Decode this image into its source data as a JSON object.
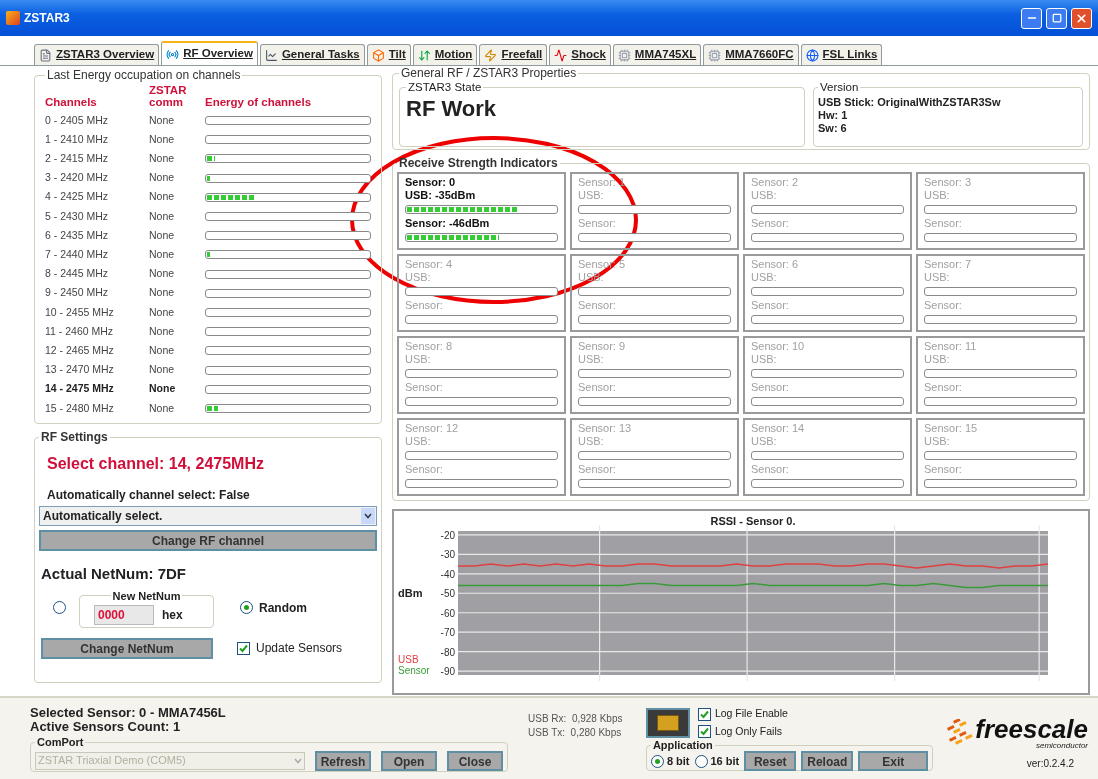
{
  "window": {
    "title": "ZSTAR3"
  },
  "tabs": [
    {
      "label": "ZSTAR3 Overview",
      "selected": false
    },
    {
      "label": "RF Overview",
      "selected": true
    },
    {
      "label": "General Tasks",
      "selected": false
    },
    {
      "label": "Tilt",
      "selected": false
    },
    {
      "label": "Motion",
      "selected": false
    },
    {
      "label": "Freefall",
      "selected": false
    },
    {
      "label": "Shock",
      "selected": false
    },
    {
      "label": "MMA745XL",
      "selected": false
    },
    {
      "label": "MMA7660FC",
      "selected": false
    },
    {
      "label": "FSL Links",
      "selected": false
    }
  ],
  "energy_panel": {
    "title": "Last Energy occupation on channels",
    "columns": [
      "Channels",
      "ZSTAR comm",
      "Energy of channels"
    ],
    "channels": [
      {
        "name": "0 - 2405 MHz",
        "comm": "None",
        "level": 0,
        "selected": false
      },
      {
        "name": "1 - 2410 MHz",
        "comm": "None",
        "level": 0,
        "selected": false
      },
      {
        "name": "2 - 2415 MHz",
        "comm": "None",
        "level": 0.05,
        "selected": false
      },
      {
        "name": "3 - 2420 MHz",
        "comm": "None",
        "level": 0.02,
        "selected": false
      },
      {
        "name": "4 - 2425 MHz",
        "comm": "None",
        "level": 0.3,
        "selected": false
      },
      {
        "name": "5 - 2430 MHz",
        "comm": "None",
        "level": 0,
        "selected": false
      },
      {
        "name": "6 - 2435 MHz",
        "comm": "None",
        "level": 0,
        "selected": false
      },
      {
        "name": "7 - 2440 MHz",
        "comm": "None",
        "level": 0.02,
        "selected": false
      },
      {
        "name": "8 - 2445 MHz",
        "comm": "None",
        "level": 0,
        "selected": false
      },
      {
        "name": "9 - 2450 MHz",
        "comm": "None",
        "level": 0,
        "selected": false
      },
      {
        "name": "10 - 2455 MHz",
        "comm": "None",
        "level": 0,
        "selected": false
      },
      {
        "name": "11 - 2460 MHz",
        "comm": "None",
        "level": 0,
        "selected": false
      },
      {
        "name": "12 - 2465 MHz",
        "comm": "None",
        "level": 0,
        "selected": false
      },
      {
        "name": "13 - 2470 MHz",
        "comm": "None",
        "level": 0,
        "selected": false
      },
      {
        "name": "14 - 2475 MHz",
        "comm": "None",
        "level": 0,
        "selected": true
      },
      {
        "name": "15 - 2480 MHz",
        "comm": "None",
        "level": 0.07,
        "selected": false
      }
    ]
  },
  "rf_settings": {
    "title": "RF Settings",
    "selected_channel": "Select channel: 14, 2475MHz",
    "auto_status": "Automatically channel select: False",
    "dropdown_value": "Automatically select.",
    "change_channel_button": "Change RF channel",
    "actual_netnum": "Actual NetNum: 7DF",
    "netnum_group": "New NetNum",
    "netnum_radio_selected": false,
    "netnum_value": "0000",
    "netnum_unit": "hex",
    "random_label": "Random",
    "random_selected": true,
    "change_netnum_button": "Change NetNum",
    "update_sensors_label": "Update Sensors",
    "update_sensors_checked": true
  },
  "properties": {
    "title": "General RF / ZSTAR3 Properties",
    "state_title": "ZSTAR3 State",
    "state": "RF Work",
    "version_title": "Version",
    "version_lines": [
      "USB Stick: OriginalWithZSTAR3Sw",
      "Hw: 1",
      "Sw: 6"
    ]
  },
  "indicators": {
    "title": "Receive Strength Indicators",
    "sensors": [
      {
        "title": "Sensor: 0",
        "usb": {
          "label": "USB: -35dBm",
          "level": 0.75
        },
        "sensor": {
          "label": "Sensor: -46dBm",
          "level": 0.62
        },
        "active": true
      },
      {
        "title": "Sensor: 1",
        "usb": {
          "label": "USB:",
          "level": 0
        },
        "sensor": {
          "label": "Sensor:",
          "level": 0
        },
        "active": false
      },
      {
        "title": "Sensor: 2",
        "usb": {
          "label": "USB:",
          "level": 0
        },
        "sensor": {
          "label": "Sensor:",
          "level": 0
        },
        "active": false
      },
      {
        "title": "Sensor: 3",
        "usb": {
          "label": "USB:",
          "level": 0
        },
        "sensor": {
          "label": "Sensor:",
          "level": 0
        },
        "active": false
      },
      {
        "title": "Sensor: 4",
        "usb": {
          "label": "USB:",
          "level": 0
        },
        "sensor": {
          "label": "Sensor:",
          "level": 0
        },
        "active": false
      },
      {
        "title": "Sensor: 5",
        "usb": {
          "label": "USB:",
          "level": 0
        },
        "sensor": {
          "label": "Sensor:",
          "level": 0
        },
        "active": false
      },
      {
        "title": "Sensor: 6",
        "usb": {
          "label": "USB:",
          "level": 0
        },
        "sensor": {
          "label": "Sensor:",
          "level": 0
        },
        "active": false
      },
      {
        "title": "Sensor: 7",
        "usb": {
          "label": "USB:",
          "level": 0
        },
        "sensor": {
          "label": "Sensor:",
          "level": 0
        },
        "active": false
      },
      {
        "title": "Sensor: 8",
        "usb": {
          "label": "USB:",
          "level": 0
        },
        "sensor": {
          "label": "Sensor:",
          "level": 0
        },
        "active": false
      },
      {
        "title": "Sensor: 9",
        "usb": {
          "label": "USB:",
          "level": 0
        },
        "sensor": {
          "label": "Sensor:",
          "level": 0
        },
        "active": false
      },
      {
        "title": "Sensor: 10",
        "usb": {
          "label": "USB:",
          "level": 0
        },
        "sensor": {
          "label": "Sensor:",
          "level": 0
        },
        "active": false
      },
      {
        "title": "Sensor: 11",
        "usb": {
          "label": "USB:",
          "level": 0
        },
        "sensor": {
          "label": "Sensor:",
          "level": 0
        },
        "active": false
      },
      {
        "title": "Sensor: 12",
        "usb": {
          "label": "USB:",
          "level": 0
        },
        "sensor": {
          "label": "Sensor:",
          "level": 0
        },
        "active": false
      },
      {
        "title": "Sensor: 13",
        "usb": {
          "label": "USB:",
          "level": 0
        },
        "sensor": {
          "label": "Sensor:",
          "level": 0
        },
        "active": false
      },
      {
        "title": "Sensor: 14",
        "usb": {
          "label": "USB:",
          "level": 0
        },
        "sensor": {
          "label": "Sensor:",
          "level": 0
        },
        "active": false
      },
      {
        "title": "Sensor: 15",
        "usb": {
          "label": "USB:",
          "level": 0
        },
        "sensor": {
          "label": "Sensor:",
          "level": 0
        },
        "active": false
      }
    ]
  },
  "rssi_chart": {
    "chart_data": {
      "type": "line",
      "grid": true,
      "title": "RSSI - Sensor 0.",
      "ylabel": "dBm",
      "ylim": [
        -92,
        -18
      ],
      "yticks": [
        -20,
        -30,
        -40,
        -50,
        -60,
        -70,
        -80,
        -90
      ],
      "series": [
        {
          "name": "USB",
          "color": "#e04040",
          "values": [
            -36,
            -36,
            -35,
            -36,
            -35,
            -36,
            -35,
            -36,
            -35,
            -36,
            -36,
            -35,
            -35,
            -36,
            -36,
            -36,
            -36,
            -35,
            -36,
            -36,
            -35,
            -35,
            -35,
            -36,
            -36,
            -35,
            -35,
            -36,
            -37,
            -36,
            -35,
            -36,
            -36,
            -37,
            -36,
            -36,
            -35
          ]
        },
        {
          "name": "Sensor",
          "color": "#3a9a3a",
          "values": [
            -46,
            -46,
            -46,
            -46,
            -46,
            -46,
            -46,
            -46,
            -46,
            -46,
            -46,
            -45,
            -45,
            -46,
            -46,
            -46,
            -46,
            -46,
            -45,
            -46,
            -46,
            -46,
            -46,
            -46,
            -46,
            -46,
            -45,
            -46,
            -46,
            -45,
            -46,
            -47,
            -47,
            -46,
            -46,
            -46,
            -46
          ]
        }
      ]
    }
  },
  "status": {
    "selected_sensor": "Selected Sensor: 0 - MMA7456L",
    "active_count": "Active Sensors Count: 1",
    "comport_title": "ComPort",
    "comport_value": "ZSTAR Triaxial Demo (COM5)",
    "comport_buttons": [
      "Refresh",
      "Open",
      "Close"
    ],
    "usb_rx": "USB Rx:  0,928 Kbps",
    "usb_tx": "USB Tx:  0,280 Kbps",
    "log_options": [
      {
        "label": "Log File Enable",
        "checked": true
      },
      {
        "label": "Log Only Fails",
        "checked": true
      }
    ],
    "application_title": "Application",
    "bit_options": [
      {
        "label": "8 bit",
        "selected": true
      },
      {
        "label": "16 bit",
        "selected": false
      }
    ],
    "app_buttons": [
      "Reset",
      "Reload",
      "Exit"
    ],
    "logo_text": "freescale",
    "logo_subtext": "semiconductor",
    "version": "ver:0.2.4.2"
  }
}
